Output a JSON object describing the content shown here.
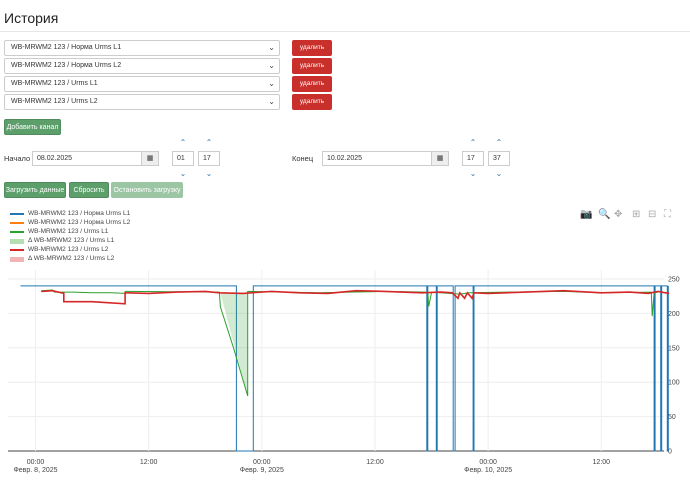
{
  "page": {
    "title": "История"
  },
  "channels": [
    {
      "label": "WB-MRWM2 123 / Норма Urms L1",
      "delete_label": "удалить"
    },
    {
      "label": "WB-MRWM2 123 / Норма Urms L2",
      "delete_label": "удалить"
    },
    {
      "label": "WB-MRWM2 123 / Urms L1",
      "delete_label": "удалить"
    },
    {
      "label": "WB-MRWM2 123 / Urms L2",
      "delete_label": "удалить"
    }
  ],
  "add_channel_label": "Добавить канал",
  "range": {
    "start_label": "Начало",
    "start_date": "08.02.2025",
    "start_hour": "01",
    "start_minute": "17",
    "end_label": "Конец",
    "end_date": "10.02.2025",
    "end_hour": "17",
    "end_minute": "37"
  },
  "actions": {
    "load": "Загрузить данные",
    "reset": "Сбросить",
    "stop": "Остановить загрузку"
  },
  "modebar_icons": [
    "camera-icon",
    "zoom-icon",
    "pan-icon",
    "zoom-in-icon",
    "zoom-out-icon",
    "autoscale-icon"
  ],
  "chart_data": {
    "type": "line",
    "y_ticks": [
      "250",
      "200",
      "150",
      "100",
      "50",
      "0"
    ],
    "ylim": [
      0,
      250
    ],
    "x_ticks": [
      {
        "time": "00:00",
        "date": "Февр. 8, 2025"
      },
      {
        "time": "12:00",
        "date": ""
      },
      {
        "time": "00:00",
        "date": "Февр. 9, 2025"
      },
      {
        "time": "12:00",
        "date": ""
      },
      {
        "time": "00:00",
        "date": "Февр. 10, 2025"
      },
      {
        "time": "12:00",
        "date": ""
      }
    ],
    "grid": true,
    "legend_position": "top-left",
    "series": [
      {
        "name": "WB-MRWM2 123 / Норма Urms L1",
        "color": "#1f77b4",
        "points": [
          [
            -1.6,
            240
          ],
          [
            21.3,
            240
          ],
          [
            21.3,
            0
          ],
          [
            23.1,
            0
          ],
          [
            23.1,
            240
          ],
          [
            41.5,
            240
          ],
          [
            41.5,
            0
          ],
          [
            41.6,
            0
          ],
          [
            41.6,
            240
          ],
          [
            42.5,
            240
          ],
          [
            42.5,
            0
          ],
          [
            42.6,
            0
          ],
          [
            42.6,
            240
          ],
          [
            44.3,
            240
          ],
          [
            44.3,
            0
          ],
          [
            44.5,
            0
          ],
          [
            44.5,
            240
          ],
          [
            46.4,
            240
          ],
          [
            46.4,
            0
          ],
          [
            46.5,
            0
          ],
          [
            46.5,
            240
          ],
          [
            65.6,
            240
          ],
          [
            65.6,
            0
          ],
          [
            65.7,
            0
          ],
          [
            65.7,
            240
          ],
          [
            66.3,
            240
          ],
          [
            66.3,
            0
          ],
          [
            66.4,
            0
          ],
          [
            66.4,
            240
          ],
          [
            67.0,
            240
          ],
          [
            67.0,
            0
          ],
          [
            67.1,
            0
          ],
          [
            67.1,
            240
          ]
        ]
      },
      {
        "name": "WB-MRWM2 123 / Норма Urms L2",
        "color": "#ff7f0e",
        "points": []
      },
      {
        "name": "WB-MRWM2 123 / Urms L1",
        "color": "#2ca02c",
        "points": [
          [
            0.6,
            233
          ],
          [
            1.8,
            234
          ],
          [
            2.0,
            231
          ],
          [
            4.0,
            231
          ],
          [
            6.0,
            230
          ],
          [
            8.0,
            230
          ],
          [
            9.5,
            229
          ],
          [
            9.5,
            232
          ],
          [
            19.5,
            231
          ],
          [
            19.6,
            210
          ],
          [
            21.0,
            150
          ],
          [
            22.5,
            80
          ],
          [
            22.5,
            232
          ],
          [
            30,
            230
          ],
          [
            37,
            232
          ],
          [
            41.6,
            231
          ],
          [
            41.7,
            210
          ],
          [
            42.0,
            231
          ],
          [
            45,
            228
          ],
          [
            46,
            230
          ],
          [
            50,
            231
          ],
          [
            56,
            232
          ],
          [
            60,
            230
          ],
          [
            65.3,
            231
          ],
          [
            65.4,
            196
          ],
          [
            65.6,
            230
          ],
          [
            66.0,
            231
          ]
        ]
      },
      {
        "name": "Δ WB-MRWM2 123 / Urms L1",
        "color": "#2ca02c",
        "area": true,
        "opacity": 0.22,
        "points": [
          [
            19.6,
            230
          ],
          [
            22.5,
            80
          ],
          [
            22.5,
            230
          ]
        ]
      },
      {
        "name": "WB-MRWM2 123 / Urms L2",
        "color": "#d62728",
        "points": [
          [
            0.6,
            232
          ],
          [
            1.8,
            233
          ],
          [
            3.0,
            229
          ],
          [
            3.0,
            217
          ],
          [
            6.0,
            217
          ],
          [
            9.5,
            214
          ],
          [
            9.5,
            230
          ],
          [
            12,
            229
          ],
          [
            15,
            231
          ],
          [
            18,
            232
          ],
          [
            19.5,
            230
          ],
          [
            22,
            229
          ],
          [
            25,
            232
          ],
          [
            28,
            230
          ],
          [
            31,
            229
          ],
          [
            34,
            233
          ],
          [
            37,
            232
          ],
          [
            41,
            230
          ],
          [
            43,
            231
          ],
          [
            44.2,
            230
          ],
          [
            44.8,
            222
          ],
          [
            45,
            230
          ],
          [
            45.5,
            222
          ],
          [
            45.8,
            230
          ],
          [
            46.3,
            222
          ],
          [
            46.5,
            230
          ],
          [
            48,
            229
          ],
          [
            52,
            231
          ],
          [
            56,
            233
          ],
          [
            60,
            230
          ],
          [
            63,
            231
          ],
          [
            65,
            229
          ],
          [
            66,
            232
          ],
          [
            67.2,
            229
          ]
        ]
      },
      {
        "name": "Δ WB-MRWM2 123 / Urms L2",
        "color": "#d62728",
        "area": true,
        "opacity": 0.22,
        "points": [
          [
            9.5,
            234
          ],
          [
            9.5,
            212
          ]
        ]
      }
    ]
  }
}
